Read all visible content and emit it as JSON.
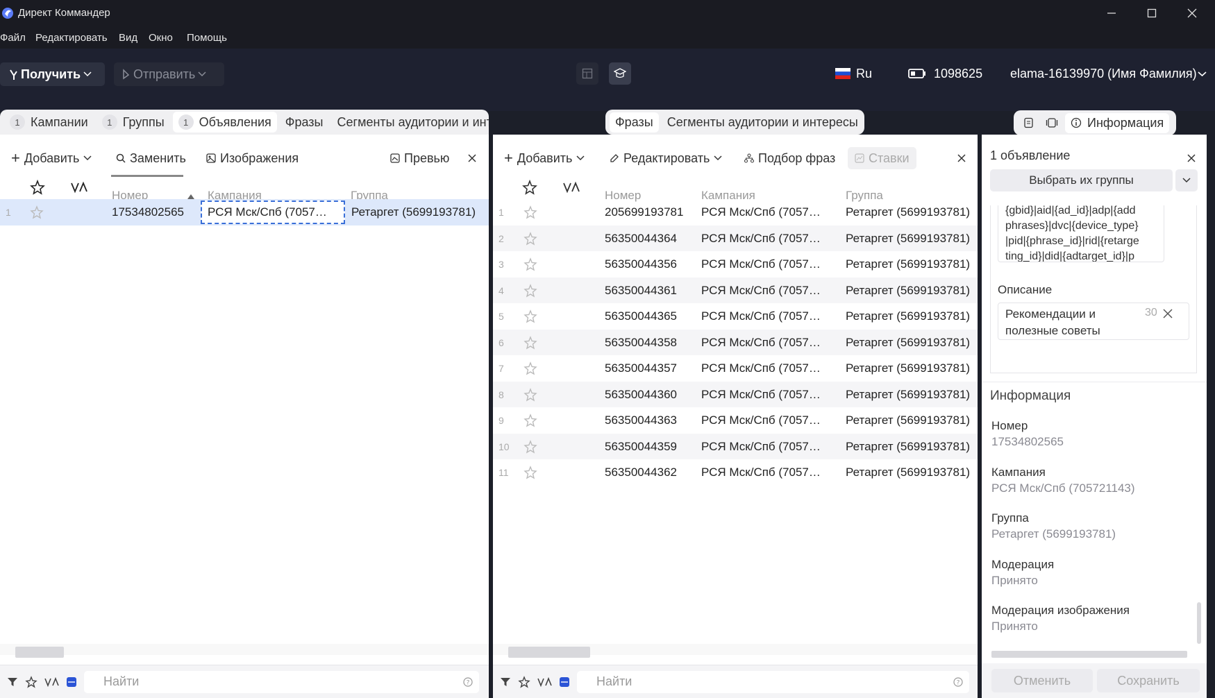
{
  "window": {
    "title": "Директ Коммандер"
  },
  "menu": [
    "Файл",
    "Редактировать",
    "Вид",
    "Окно",
    "Помощь"
  ],
  "toolbar": {
    "get": "Получить",
    "send": "Отправить",
    "lang": "Ru",
    "balance": "1098625",
    "account": "elama-16139970 (Имя Фамилия)"
  },
  "left": {
    "tabs": [
      {
        "badge": "1",
        "label": "Кампании"
      },
      {
        "badge": "1",
        "label": "Группы"
      },
      {
        "badge": "1",
        "label": "Объявления"
      },
      {
        "label": "Фразы"
      },
      {
        "label": "Сегменты аудитории и интересы"
      }
    ],
    "add": "Добавить",
    "replace": "Заменить",
    "images": "Изображения",
    "preview": "Превью",
    "columns": {
      "num": "Номер",
      "campaign": "Кампания",
      "group": "Группа"
    },
    "rows": [
      {
        "n": "1",
        "id": "17534802565",
        "campaign": "РСЯ Мск/Спб (7057…",
        "group": "Ретаргет (5699193781)"
      }
    ],
    "search_placeholder": "Найти"
  },
  "middle": {
    "tabs": [
      "Фразы",
      "Сегменты аудитории и интересы"
    ],
    "add": "Добавить",
    "edit": "Редактировать",
    "pick": "Подбор фраз",
    "bids": "Ставки",
    "columns": {
      "num": "Номер",
      "campaign": "Кампания",
      "group": "Группа"
    },
    "rows": [
      {
        "n": "1",
        "id": "205699193781",
        "campaign": "РСЯ Мск/Спб (7057…",
        "group": "Ретаргет (5699193781)"
      },
      {
        "n": "2",
        "id": "56350044364",
        "campaign": "РСЯ Мск/Спб (7057…",
        "group": "Ретаргет (5699193781)"
      },
      {
        "n": "3",
        "id": "56350044356",
        "campaign": "РСЯ Мск/Спб (7057…",
        "group": "Ретаргет (5699193781)"
      },
      {
        "n": "4",
        "id": "56350044361",
        "campaign": "РСЯ Мск/Спб (7057…",
        "group": "Ретаргет (5699193781)"
      },
      {
        "n": "5",
        "id": "56350044365",
        "campaign": "РСЯ Мск/Спб (7057…",
        "group": "Ретаргет (5699193781)"
      },
      {
        "n": "6",
        "id": "56350044358",
        "campaign": "РСЯ Мск/Спб (7057…",
        "group": "Ретаргет (5699193781)"
      },
      {
        "n": "7",
        "id": "56350044357",
        "campaign": "РСЯ Мск/Спб (7057…",
        "group": "Ретаргет (5699193781)"
      },
      {
        "n": "8",
        "id": "56350044360",
        "campaign": "РСЯ Мск/Спб (7057…",
        "group": "Ретаргет (5699193781)"
      },
      {
        "n": "9",
        "id": "56350044363",
        "campaign": "РСЯ Мск/Спб (7057…",
        "group": "Ретаргет (5699193781)"
      },
      {
        "n": "10",
        "id": "56350044359",
        "campaign": "РСЯ Мск/Спб (7057…",
        "group": "Ретаргет (5699193781)"
      },
      {
        "n": "11",
        "id": "56350044362",
        "campaign": "РСЯ Мск/Спб (7057…",
        "group": "Ретаргет (5699193781)"
      }
    ],
    "search_placeholder": "Найти"
  },
  "right": {
    "tab": "Информация",
    "count": "1 объявление",
    "select_groups": "Выбрать их группы",
    "url_lines": [
      "{gbid}|aid|{ad_id}|adp|{add",
      "phrases}|dvc|{device_type}",
      "|pid|{phrase_id}|rid|{retarge",
      "ting_id}|did|{adtarget_id}|p"
    ],
    "desc_label": "Описание",
    "desc_lines": [
      "Рекомендации и",
      "полезные советы"
    ],
    "desc_counter": "30",
    "info_title": "Информация",
    "fields": [
      {
        "label": "Номер",
        "value": "17534802565"
      },
      {
        "label": "Кампания",
        "value": "РСЯ Мск/Спб (705721143)"
      },
      {
        "label": "Группа",
        "value": "Ретаргет (5699193781)"
      },
      {
        "label": "Модерация",
        "value": "Принято"
      },
      {
        "label": "Модерация изображения",
        "value": "Принято"
      }
    ],
    "cancel": "Отменить",
    "save": "Сохранить"
  }
}
